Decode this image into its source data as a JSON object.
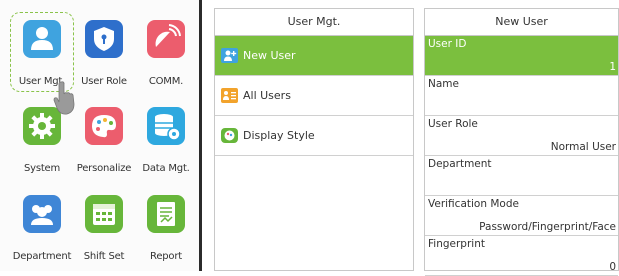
{
  "main_menu": {
    "tiles": [
      {
        "label": "User Mgt.",
        "icon": "user-icon",
        "color": "#3fa3df"
      },
      {
        "label": "User Role",
        "icon": "shield-icon",
        "color": "#2e6fcb"
      },
      {
        "label": "COMM.",
        "icon": "satellite-dish-icon",
        "color": "#ec5d6d"
      },
      {
        "label": "System",
        "icon": "gear-icon",
        "color": "#67b63a"
      },
      {
        "label": "Personalize",
        "icon": "palette-icon",
        "color": "#ec5d6d"
      },
      {
        "label": "Data Mgt.",
        "icon": "database-gear-icon",
        "color": "#2ea8df"
      },
      {
        "label": "Department",
        "icon": "group-icon",
        "color": "#3f86d6"
      },
      {
        "label": "Shift Set",
        "icon": "calendar-icon",
        "color": "#67b63a"
      },
      {
        "label": "Report",
        "icon": "report-icon",
        "color": "#67b63a"
      }
    ]
  },
  "user_mgt": {
    "title": "User Mgt.",
    "items": [
      {
        "label": "New User",
        "icon": "add-user-icon"
      },
      {
        "label": "All Users",
        "icon": "user-list-icon"
      },
      {
        "label": "Display Style",
        "icon": "display-style-icon"
      }
    ]
  },
  "new_user": {
    "title": "New User",
    "fields": [
      {
        "key": "User ID",
        "value": "1"
      },
      {
        "key": "Name",
        "value": ""
      },
      {
        "key": "User Role",
        "value": "Normal User"
      },
      {
        "key": "Department",
        "value": ""
      },
      {
        "key": "Verification Mode",
        "value": "Password/Fingerprint/Face"
      },
      {
        "key": "Fingerprint",
        "value": "0"
      }
    ]
  },
  "colors": {
    "accent_green": "#7bbf3e",
    "panel_border": "#c8c8c8"
  }
}
